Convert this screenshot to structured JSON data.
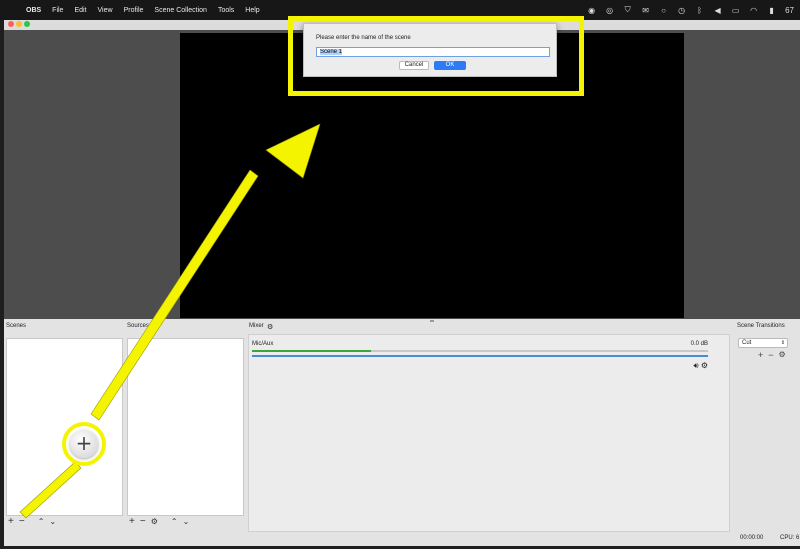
{
  "menubar": {
    "apple_glyph": "",
    "app_name": "OBS",
    "items": [
      "File",
      "Edit",
      "View",
      "Profile",
      "Scene Collection",
      "Tools",
      "Help"
    ],
    "battery_text": "67"
  },
  "panels": {
    "scenes_label": "Scenes",
    "sources_label": "Sources",
    "mixer_label": "Mixer",
    "transitions_label": "Scene Transitions"
  },
  "mixer": {
    "track_name": "Mic/Aux",
    "db_value": "0.0 dB",
    "level_fraction": 0.26
  },
  "transitions": {
    "selected": "Cut"
  },
  "statusbar": {
    "time": "00:00:00",
    "cpu": "CPU: 6"
  },
  "dialog": {
    "prompt": "Please enter the name of the scene",
    "input_value": "Scene 1",
    "cancel_label": "Cancel",
    "ok_label": "OK"
  },
  "toolbar_glyphs": {
    "add": "+",
    "remove": "−",
    "up": "⌃",
    "down": "⌄",
    "gear": "⚙"
  },
  "colors": {
    "highlight": "#f4f400",
    "ok_button": "#2d7cf6",
    "meter_green": "#3aa53a",
    "fader_blue": "#4a8ad6"
  },
  "icons": [
    "apple-icon",
    "gear-icon",
    "plus-icon",
    "minus-icon",
    "chevron-up-icon",
    "chevron-down-icon",
    "speaker-icon",
    "wifi-icon",
    "bluetooth-icon",
    "battery-icon"
  ]
}
